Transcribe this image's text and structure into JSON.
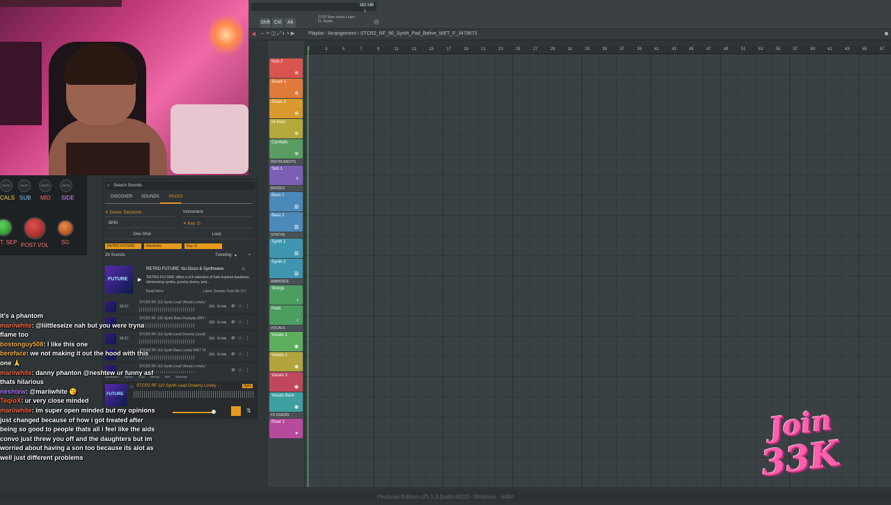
{
  "fl": {
    "hint_line1": "07/02  New series Learn",
    "hint_line2": "FL Studio",
    "memory": "382 MB",
    "mem_sub": "1",
    "mod_shift": "Shift",
    "mod_ctrl": "Ctrl",
    "mod_alt": "Alt",
    "playlist_title": "Playlist - Arrangement  ›  STCR2_RF_90_Synth_Pad_Belive_WET_F_3479673",
    "footer": "Producer Edition v25.1.3 [build 4922] - Windows - 64Bit"
  },
  "timeline": {
    "ticks": [
      "1",
      "3",
      "5",
      "7",
      "9",
      "11",
      "13",
      "15",
      "17",
      "19",
      "21",
      "23",
      "25",
      "27",
      "29",
      "31",
      "33",
      "35",
      "37",
      "39",
      "41",
      "43",
      "45",
      "47",
      "49",
      "51",
      "53",
      "55",
      "57",
      "59",
      "61",
      "63",
      "65",
      "67"
    ]
  },
  "tracks": [
    {
      "label": "Kick 2",
      "color": "#d9534f",
      "icon": "drum"
    },
    {
      "label": "Snare 1",
      "color": "#e07a3a",
      "icon": "drum"
    },
    {
      "label": "Snare 2",
      "color": "#d89a2e",
      "icon": "drum"
    },
    {
      "label": "Hi-Hats",
      "color": "#b3a83a",
      "icon": "drum"
    },
    {
      "label": "Cymbals",
      "color": "#5a9c61",
      "icon": "drum"
    },
    {
      "group": "INSTRUMENTS"
    },
    {
      "label": "Sub 1",
      "color": "#7a5fb4",
      "icon": "bass"
    },
    {
      "group": "BASSES"
    },
    {
      "label": "Bass 1",
      "color": "#4a89b8",
      "icon": "keys"
    },
    {
      "label": "Bass 2",
      "color": "#4a89b8",
      "icon": "keys"
    },
    {
      "group": "SYNTHS"
    },
    {
      "label": "Synth 1",
      "color": "#3e95b0",
      "icon": "keys"
    },
    {
      "label": "Synth 2",
      "color": "#3e95b0",
      "icon": "keys"
    },
    {
      "group": "AMBIENCE"
    },
    {
      "label": "Strings",
      "color": "#4d9d60",
      "icon": "note"
    },
    {
      "label": "Pads",
      "color": "#4d9d60",
      "icon": "note"
    },
    {
      "group": "VOCALS"
    },
    {
      "label": "Vocals 1",
      "color": "#5dad5c",
      "icon": "voice"
    },
    {
      "label": "Vocals 2",
      "color": "#b2a33c",
      "icon": "voice"
    },
    {
      "label": "Vocals 3",
      "color": "#c0485c",
      "icon": "voice"
    },
    {
      "label": "Vocals Back",
      "color": "#3e9fa0",
      "icon": "voice"
    },
    {
      "group": "FX RISERS"
    },
    {
      "label": "Riser 1",
      "color": "#b84a9e",
      "icon": "fx"
    }
  ],
  "plugin": {
    "bands": [
      "CALS",
      "SUB",
      "MID",
      "SIDE"
    ],
    "mute": "MUTE",
    "knob1": "T. SEP",
    "knob2": "POST VOL",
    "knob3": "SG"
  },
  "browser": {
    "search_placeholder": "Search Sounds",
    "tabs": [
      "DISCOVER",
      "SOUNDS",
      "PACKS"
    ],
    "filter_genre": "Genre: Electronic",
    "filter_instrument": "Instrument",
    "filter_bpm": "BPM",
    "filter_key": "Key: G",
    "oneshot": "One-Shot",
    "loop": "Loop",
    "chips": [
      "RETRO FUTURE: N...",
      "Electronic",
      "Key: G"
    ],
    "count": "29 Sounds",
    "sort": "Trending",
    "pack_title": "RETRO FUTURE: Nu Disco & Synthwave",
    "pack_desc": "'RETRO FUTURE' offers a rich selection of funk-inspired basslines, shimmering synths, punchy drums, and...",
    "read_more": "Read More",
    "label": "Label: Sample Tools By Cr2",
    "pack_logo": "FUTURE",
    "sounds": [
      {
        "dur": "00:17",
        "name": "STCR2 RF 110 Synth Lead Vibrato Lonely W...",
        "bpm": "110",
        "key": "G min"
      },
      {
        "dur": "",
        "name": "STCR2 RF 120 Synth Bass Readytip DRY G...",
        "bpm": "120",
        "key": "G min"
      },
      {
        "dur": "00:17",
        "name": "STCR2 RF 110 Synth Lead Dreamy Lonely W...",
        "bpm": "110",
        "key": "G min"
      },
      {
        "dur": "",
        "name": "STCR2 RF 110 Synth Bass Lonely WET SC G...",
        "bpm": "110",
        "key": "G min"
      },
      {
        "dur": "",
        "name": "STCR2 RF 110 Synth Lead Vibrato Lonely W...",
        "bpm": "",
        "key": ""
      }
    ],
    "tags": [
      "Synthwave",
      "Synths",
      "Lead",
      "Melody",
      "Wet",
      "Sidechain"
    ],
    "now_playing": "STCR2 RF 110 Synth Lead Dreamy Lonely ...",
    "np_badge": "Sync"
  },
  "chat": [
    {
      "user": "",
      "text": "it's a phantom",
      "color": "uname2"
    },
    {
      "user": "mariiwhite",
      "text": ": @liittleseize nah but you were tryna flame too",
      "color": "uname"
    },
    {
      "user": "bostonguy508",
      "text": ": I like this one",
      "color": "uname3"
    },
    {
      "user": "bereface",
      "text": ": we not making it out the hood with this one 🙏",
      "color": "uname3"
    },
    {
      "user": "mariiwhite",
      "text": ": danny phanton @neshtew ur funny asf thats hilarious",
      "color": "uname"
    },
    {
      "user": "neshtew",
      "text": ": @mariiwhite 😘",
      "color": "uname2"
    },
    {
      "user": "TeqioX",
      "text": ": ur very close minded",
      "color": "uname"
    },
    {
      "user": "mariiwhite",
      "text": ": im super open minded but my opinions just changed because of how i got treated after being so good to people thats all i feel like the aids convo just threw you off and the daughters but im worried about having a son too because its alot as well just different problems",
      "color": "uname"
    }
  ],
  "overlay": {
    "line1": "Join",
    "line2": "33K"
  }
}
